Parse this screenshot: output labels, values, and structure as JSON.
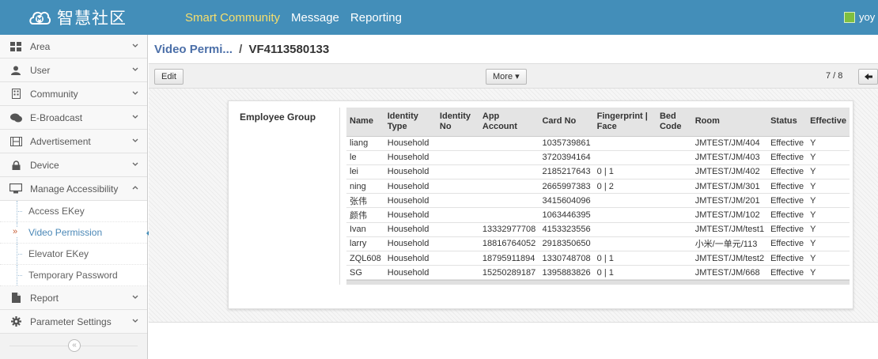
{
  "brand": {
    "name": "智慧社区"
  },
  "topnav": [
    "Smart Community",
    "Message",
    "Reporting"
  ],
  "user": {
    "name": "yoy"
  },
  "sidebar": {
    "items": [
      {
        "label": "Area",
        "icon": "grid-icon"
      },
      {
        "label": "User",
        "icon": "user-icon"
      },
      {
        "label": "Community",
        "icon": "building-icon"
      },
      {
        "label": "E-Broadcast",
        "icon": "chat-icon"
      },
      {
        "label": "Advertisement",
        "icon": "film-icon"
      },
      {
        "label": "Device",
        "icon": "lock-icon"
      },
      {
        "label": "Manage Accessibility",
        "icon": "desktop-icon"
      }
    ],
    "subitems": [
      "Access EKey",
      "Video Permission",
      "Elevator EKey",
      "Temporary Password"
    ],
    "items_after": [
      {
        "label": "Report",
        "icon": "file-icon"
      },
      {
        "label": "Parameter Settings",
        "icon": "gear-icon"
      }
    ],
    "collapse": "«"
  },
  "breadcrumb": {
    "parent": "Video Permi...",
    "separator": "/",
    "current": "VF4113580133"
  },
  "toolbar": {
    "edit": "Edit",
    "more": "More ▾",
    "pager": "7 / 8"
  },
  "group_label": "Employee Group",
  "table": {
    "headers": [
      "Name",
      "Identity Type",
      "Identity No",
      "App Account",
      "Card No",
      "Fingerprint | Face",
      "Bed Code",
      "Room",
      "Status",
      "Effective"
    ],
    "rows": [
      [
        "liang",
        "Household",
        "",
        "",
        "1035739861",
        "",
        "",
        "JMTEST/JM/404",
        "Effective",
        "Y"
      ],
      [
        "le",
        "Household",
        "",
        "",
        "3720394164",
        "",
        "",
        "JMTEST/JM/403",
        "Effective",
        "Y"
      ],
      [
        "lei",
        "Household",
        "",
        "",
        "2185217643",
        "0 | 1",
        "",
        "JMTEST/JM/402",
        "Effective",
        "Y"
      ],
      [
        "ning",
        "Household",
        "",
        "",
        "2665997383",
        "0 | 2",
        "",
        "JMTEST/JM/301",
        "Effective",
        "Y"
      ],
      [
        "张伟",
        "Household",
        "",
        "",
        "3415604096",
        "",
        "",
        "JMTEST/JM/201",
        "Effective",
        "Y"
      ],
      [
        "颜伟",
        "Household",
        "",
        "",
        "1063446395",
        "",
        "",
        "JMTEST/JM/102",
        "Effective",
        "Y"
      ],
      [
        "Ivan",
        "Household",
        "",
        "13332977708",
        "4153323556",
        "",
        "",
        "JMTEST/JM/test1",
        "Effective",
        "Y"
      ],
      [
        "larry",
        "Household",
        "",
        "18816764052",
        "2918350650",
        "",
        "",
        "小米/一单元/113",
        "Effective",
        "Y"
      ],
      [
        "ZQL608",
        "Household",
        "",
        "18795911894",
        "1330748708",
        "0 | 1",
        "",
        "JMTEST/JM/test2",
        "Effective",
        "Y"
      ],
      [
        "SG",
        "Household",
        "",
        "15250289187",
        "1395883826",
        "0 | 1",
        "",
        "JMTEST/JM/668",
        "Effective",
        "Y"
      ]
    ]
  }
}
